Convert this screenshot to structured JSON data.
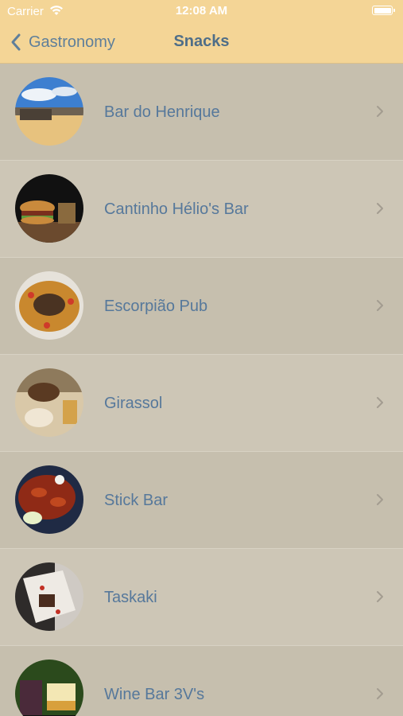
{
  "status_bar": {
    "carrier": "Carrier",
    "time": "12:08 AM"
  },
  "nav": {
    "back_label": "Gastronomy",
    "title": "Snacks"
  },
  "items": [
    {
      "label": "Bar do Henrique"
    },
    {
      "label": "Cantinho Hélio's Bar"
    },
    {
      "label": "Escorpião Pub"
    },
    {
      "label": "Girassol"
    },
    {
      "label": "Stick Bar"
    },
    {
      "label": "Taskaki"
    },
    {
      "label": "Wine Bar 3V's"
    }
  ],
  "colors": {
    "navbar": "#f4d596",
    "accent": "#56789b",
    "row_bg": "#c6bfae"
  }
}
